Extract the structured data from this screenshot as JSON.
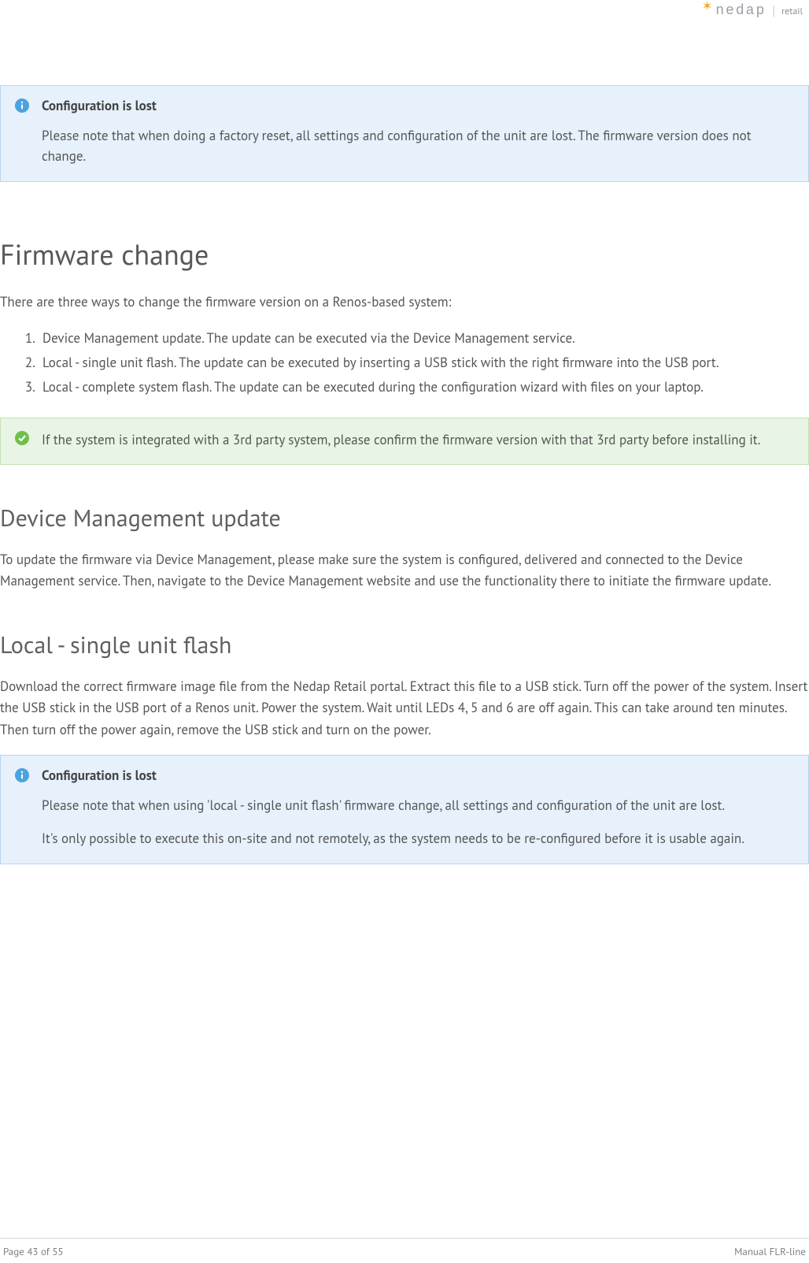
{
  "header": {
    "brand": "nedap",
    "subbrand": "retail"
  },
  "callout_reset": {
    "title": "Configuration is lost",
    "text": "Please note that when doing a factory reset, all settings and configuration of the unit are lost. The firmware version does not change."
  },
  "section_firmware": {
    "heading": "Firmware change",
    "intro": "There are three ways to change the firmware version on a Renos-based system:",
    "list": [
      "Device Management update. The update can be executed via the Device Management service.",
      "Local - single unit flash. The update can be executed by inserting a USB stick with the right firmware into the USB port.",
      "Local - complete system flash. The update can be executed during the configuration wizard with files on your laptop."
    ]
  },
  "callout_thirdparty": {
    "text": "If the system is integrated with a 3rd party system, please confirm the firmware version with that 3rd party before installing it."
  },
  "section_dm": {
    "heading": "Device Management update",
    "text": "To update the firmware via Device Management, please make sure the system is configured, delivered and connected to the Device Management service. Then, navigate to the Device Management website and use the functionality there to initiate the firmware update."
  },
  "section_local": {
    "heading": "Local - single unit flash",
    "text": "Download the correct firmware image file from the Nedap Retail portal. Extract this file to a USB stick. Turn off the power of the system. Insert the USB stick in the USB port of a Renos unit. Power the system. Wait until LEDs 4, 5 and 6 are off again. This can take around ten minutes. Then turn off the power again, remove the USB stick and turn on the power."
  },
  "callout_local": {
    "title": "Configuration is lost",
    "text": "Please note that when using 'local - single unit flash' firmware change, all settings and configuration of the unit are lost.",
    "text2": "It's only possible to execute this on-site and not remotely, as the system needs to be re-configured before it is usable again."
  },
  "footer": {
    "page": "Page 43 of 55",
    "doc": "Manual FLR-line"
  }
}
